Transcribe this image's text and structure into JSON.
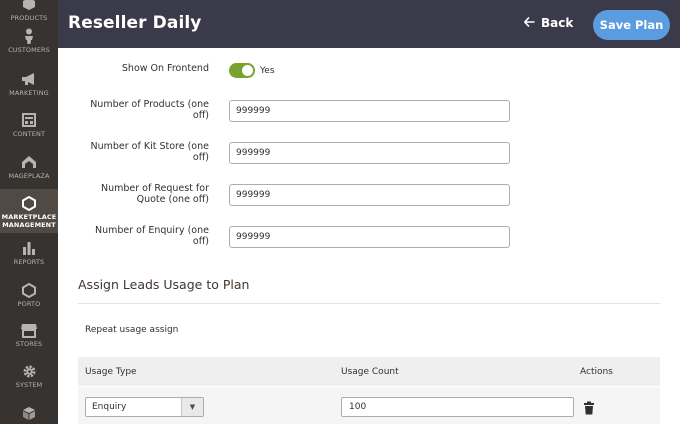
{
  "sidebar": {
    "items": [
      {
        "label": "PRODUCTS",
        "icon": "box-icon"
      },
      {
        "label": "CUSTOMERS",
        "icon": "person-icon"
      },
      {
        "label": "MARKETING",
        "icon": "megaphone-icon"
      },
      {
        "label": "CONTENT",
        "icon": "layout-icon"
      },
      {
        "label": "MAGEPLAZA",
        "icon": "mageplaza-icon"
      },
      {
        "label": "MARKETPLACE MANAGEMENT",
        "icon": "hexagon-icon",
        "active": true
      },
      {
        "label": "REPORTS",
        "icon": "bar-chart-icon"
      },
      {
        "label": "PORTO",
        "icon": "hexagon-outline-icon"
      },
      {
        "label": "STORES",
        "icon": "storefront-icon"
      },
      {
        "label": "SYSTEM",
        "icon": "gear-icon"
      },
      {
        "label": "",
        "icon": "cube-icon"
      }
    ]
  },
  "header": {
    "title": "Reseller Daily",
    "back_label": "Back",
    "save_label": "Save Plan"
  },
  "form": {
    "show_on_frontend": {
      "label": "Show On Frontend",
      "state_text": "Yes",
      "on": true
    },
    "fields": [
      {
        "label_line1": "Number of Products (one",
        "label_line2": "off)",
        "value": "999999"
      },
      {
        "label_line1": "Number of Kit Store (one",
        "label_line2": "off)",
        "value": "999999"
      },
      {
        "label_line1": "Number of Request for",
        "label_line2": "Quote (one off)",
        "value": "999999"
      },
      {
        "label_line1": "Number of Enquiry (one",
        "label_line2": "off)",
        "value": "999999"
      }
    ]
  },
  "leads": {
    "section_title": "Assign Leads Usage to Plan",
    "repeat_label": "Repeat usage assign",
    "table": {
      "headers": {
        "usage_type": "Usage Type",
        "usage_count": "Usage Count",
        "actions": "Actions"
      },
      "rows": [
        {
          "usage_type": "Enquiry",
          "usage_count": "100"
        }
      ]
    }
  },
  "colors": {
    "header_bg": "#3b3a4a",
    "sidebar_bg": "#373330",
    "accent": "#5b9ce0",
    "toggle_on": "#79a22e"
  }
}
